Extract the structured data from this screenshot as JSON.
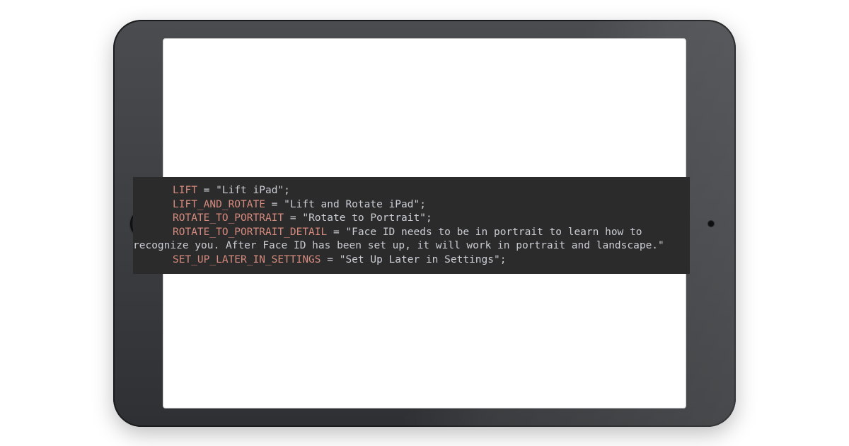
{
  "code": {
    "line1_key": "LIFT",
    "line1_val": "\"Lift iPad\";",
    "line2_key": "LIFT_AND_ROTATE",
    "line2_val": "\"Lift and Rotate iPad\";",
    "line3_key": "ROTATE_TO_PORTRAIT",
    "line3_val": "\"Rotate to Portrait\";",
    "line4_key": "ROTATE_TO_PORTRAIT_DETAIL",
    "line4_val_a": "\"Face ID needs to be in portrait to learn how to",
    "line4_val_b": "recognize you. After Face ID has been set up, it will work in portrait and landscape.\"",
    "line5_key": "SET_UP_LATER_IN_SETTINGS",
    "line5_val": "\"Set Up Later in Settings\";",
    "eq": " = "
  }
}
